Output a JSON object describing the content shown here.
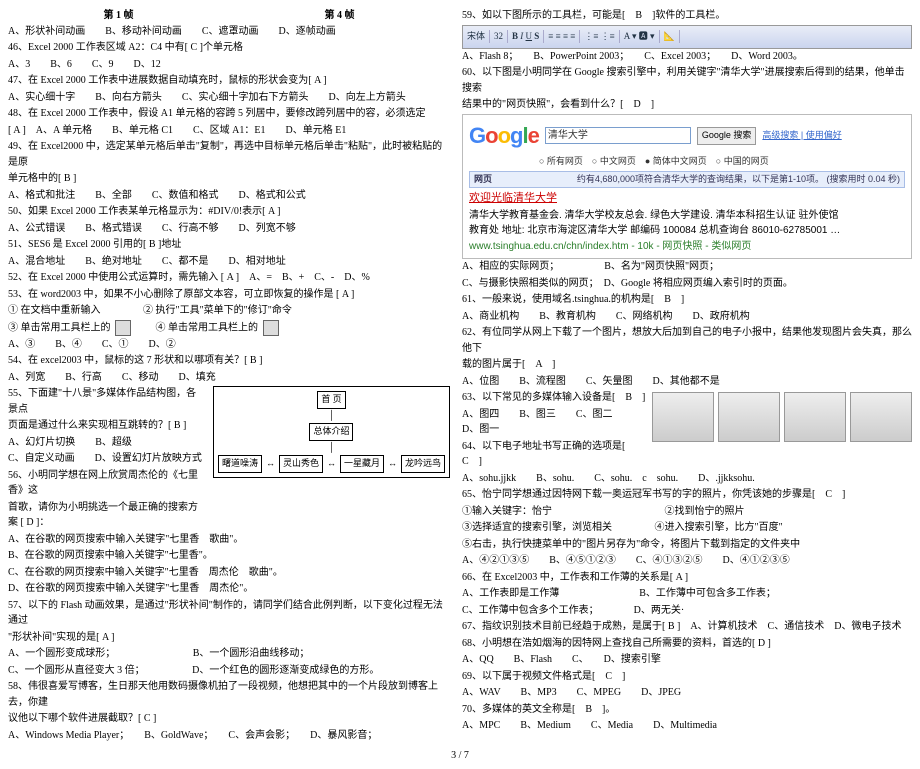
{
  "pageFooter": "3 / 7",
  "left": {
    "h1a": "第 1 帧",
    "h1b": "第 4 帧",
    "l0": "A、形状补间动画　　B、移动补间动画　　C、遮罩动画　　D、逐帧动画",
    "q46": "46、Excel 2000 工作表区域 A2：C4 中有[ C ]个单元格",
    "q46o": "A、3　　B、6　　C、9　　D、12",
    "q47": "47、在 Excel 2000 工作表中进展数据自动填充时，鼠标的形状会变为[ A ]",
    "q47o": "A、实心细十字　　B、向右方箭头　　C、实心细十字加右下方箭头　　D、向左上方箭头",
    "q48": "48、在 Excel 2000 工作表中，假设 A1 单元格的容跨 5 列居中，要修改跨列居中的容，必须选定",
    "q48l2": "[ A ]　A、A 单元格　　B、单元格 C1　　C、区域 A1：E1　　D、单元格 E1",
    "q49": "49、在 Excel2000 中，选定某单元格后单击\"复制\"，再选中目标单元格后单击\"粘贴\"，此时被粘贴的是原",
    "q49l2": "单元格中的[ B ]",
    "q49o": "A、格式和批注　　B、全部　　C、数值和格式　　D、格式和公式",
    "q50": "50、如果 Excel 2000 工作表某单元格显示为：#DIV/0!表示[ A ]",
    "q50o": "A、公式错误　　B、格式错误　　C、行高不够　　D、列宽不够",
    "q51": "51、SES6 是 Excel 2000 引用的[ B ]地址",
    "q51o": "A、混合地址　　B、绝对地址　　C、都不是　　D、相对地址",
    "q52": "52、在 Excel 2000 中使用公式运算时，需先输入 [ A ]　A、=　B、+　C、-　D、%",
    "q53": "53、在 word2003 中，如果不小心删除了原部文本容，可立即恢复的操作是 [ A ]",
    "q53step1": "①  在文档中重新输入",
    "q53step2": "②  执行\"工具\"菜单下的\"修订\"命令",
    "q53step3": "③  单击常用工具栏上的",
    "q53step4": "④  单击常用工具栏上的",
    "q53o": "A、③　　B、④　　C、①　　D、②",
    "q54": "54、在 excel2003 中，鼠标的这 7 形状和以哪项有关？[ B ]",
    "q54o": "A、列宽　　B、行高　　C、移动　　D、填充",
    "q55": "55、下面建\"十八景\"多媒体作品结构图，各景点",
    "q55l2": "页面是通过什么来实现相互跳转的？[ B ]",
    "q55o": "A、幻灯片切换　　B、超级",
    "q55o2": "C、自定义动画　　D、设置幻灯片放映方式",
    "q56": "56、小明同学想在网上欣赏周杰伦的《七里香》这",
    "q56l2": "首歌，请你为小明挑选一个最正确的搜索方案 [ D ]：",
    "q56a": "A、在谷歌的网页搜索中输入关键字\"七里香　歌曲\"。",
    "q56b": "B、在谷歌的网页搜索中输入关键字\"七里香\"。",
    "q56c": "C、在谷歌的网页搜索中输入关键字\"七里香　周杰伦　歌曲\"。",
    "q56d": "D、在谷歌的网页搜索中输入关键字\"七里香　周杰伦\"。",
    "q57": "57、以下的 Flash 动画效果，是通过\"形状补间\"制作的，请同学们结合此例判断，以下变化过程无法通过",
    "q57l2": "\"形状补间\"实现的是[ A ]",
    "q57a": "A、一个圆形变成球形；",
    "q57b": "B、一个圆形沿曲线移动；",
    "q57c": "C、一个圆形从直径变大 3 倍；",
    "q57d": "D、一个红色的圆形逐渐变成绿色的方形。",
    "q58": "58、伟很喜爱写博客，生日那天他用数码摄像机拍了一段视频，他想把其中的一个片段放到博客上去，你建",
    "q58l2": "议他以下哪个软件进展截取？[ C ]",
    "q58o": "A、Windows Media Player；　　B、GoldWave；　　C、会声会影；　　D、暴风影音；",
    "diag": {
      "root": "首 页",
      "sub": "总体介绍",
      "n1": "曙道噪涛",
      "n2": "灵山秀色",
      "n3": "一星藏月",
      "n4": "龙吟远鸟"
    }
  },
  "right": {
    "q59": "59、如以下图所示的工具栏，可能是[　B　]软件的工具栏。",
    "q59o": "A、Flash 8；　　B、PowerPoint 2003；　　C、Excel 2003；　　D、Word 2003。",
    "q60": "60、以下图是小明同学在 Google 搜索引擎中，利用关键字\"清华大学\"进展搜索后得到的结果，他单击搜索",
    "q60l2": "结果中的\"网页快照\"，会看到什么？[　D　]",
    "google": {
      "query": "清华大学",
      "btn": "Google 搜索",
      "adv": "高级搜索 | 使用偏好",
      "radios": "○ 所有网页　○ 中文网页　● 简体中文网页　○ 中国的网页",
      "tab": "网页",
      "stat": "约有4,680,000项符合清华大学的查询结果，以下是第1-10项。 (搜索用时 0.04 秒)",
      "title": "欢迎光临清华大学",
      "desc": "清华大学教育基金会. 清华大学校友总会. 绿色大学建设. 清华本科招生认证 驻外使馆",
      "desc2": "教育处 地址: 北京市海淀区清华大学 邮编码 100084 总机查询台 86010-62785001 …",
      "url": "www.tsinghua.edu.cn/chn/index.htm - 10k - 网页快照 - 类似网页"
    },
    "q60a": "A、相应的实际网页；　　　　　B、名为\"网页快照\"网页；",
    "q60b": "C、与摄影快照相类似的网页；　D、Google 将相应网页编入索引时的页面。",
    "q61": "61、一般来说，使用域名.tsinghua.的机构是[　B　]",
    "q61o": "A、商业机构　　B、教育机构　　C、网络机构　　D、政府机构",
    "q62": "62、有位同学从网上下载了一个图片，想放大后加到自己的电子小报中，结果他发现图片会失真，那么他下",
    "q62l2": "载的图片属于[　A　]",
    "q62o": "A、位图　　B、流程图　　C、矢量图　　D、其他都不是",
    "q63": "63、以下常见的多媒体输入设备是[　B　]",
    "q63o": "A、图四　　B、图三　　C、图二　　D、图一",
    "q64": "64、以下电子地址书写正确的选项是[　C　]",
    "q64o": "A、sohu.jjkk　　B、sohu.　　C、sohu.　c　sohu.　　D、.jjkksohu.",
    "q65": "65、怡宁同学想通过因特网下载一奥运冠军书写的字的照片，你凭该她的步骤是[　C　]",
    "q65s1": "①输入关键字：怡宁",
    "q65s2": "②找到怡宁的照片",
    "q65s3": "③选择适宜的搜索引擎，浏览相关",
    "q65s4": "④进入搜索引擎，比方\"百度\"",
    "q65s5": "⑤右击，执行快捷菜单中的\"图片另存为\"命令，将图片下载到指定的文件夹中",
    "q65o": "A、④②①③⑤　　B、④⑤①②③　　C、④①③②⑤　　D、④①②③⑤",
    "q66": "66、在 Excel2003 中，工作表和工作薄的关系是[ A ]",
    "q66a": "A、工作表即是工作薄　　　　　　　　B、工作薄中可包含多工作表；",
    "q66b": "C、工作薄中包含多个工作表；　　　　D、两无关·",
    "q67": "67、指纹识别技术目前已经趋于成熟，是属于[ B ]　A、计算机技术　C、通信技术　D、微电子技术",
    "q68": "68、小明想在浩如烟海的因特网上查找自己所需要的资料，首选的[ D ]",
    "q68o": "A、QQ　　B、Flash　　C、　　D、搜索引擎",
    "q69": "69、以下属于视频文件格式是[　C　]",
    "q69o": "A、WAV　　B、MP3　　C、MPEG　　D、JPEG",
    "q70": "70、多媒体的英文全称是[　B　]。",
    "q70o": "A、MPC　　B、Medium　　C、Media　　D、Multimedia"
  }
}
